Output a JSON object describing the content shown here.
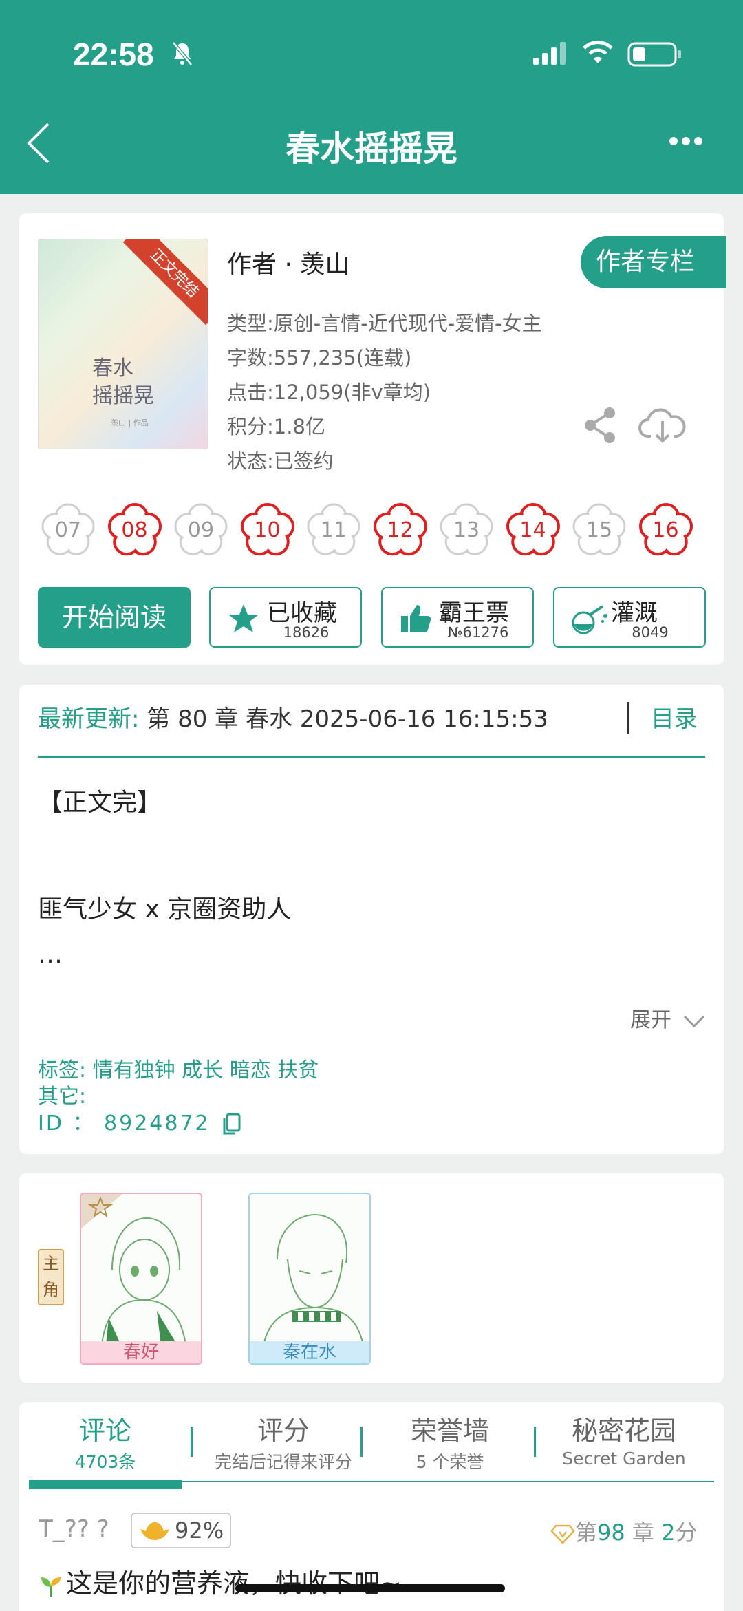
{
  "status": {
    "time": "22:58"
  },
  "nav": {
    "title": "春水摇摇晃"
  },
  "book": {
    "cover_title": "春水\n摇摇晃",
    "cover_sub": "羡山 | 作品",
    "ribbon": "正文完结",
    "author": "作者 · 羡山",
    "author_column": "作者专栏",
    "type": "类型:原创-言情-近代现代-爱情-女主",
    "words": "字数:557,235(连载)",
    "clicks": "点击:12,059(非v章均)",
    "score": "积分:1.8亿",
    "state": "状态:已签约"
  },
  "flowers": [
    {
      "n": "07",
      "red": false
    },
    {
      "n": "08",
      "red": true
    },
    {
      "n": "09",
      "red": false
    },
    {
      "n": "10",
      "red": true
    },
    {
      "n": "11",
      "red": false
    },
    {
      "n": "12",
      "red": true
    },
    {
      "n": "13",
      "red": false
    },
    {
      "n": "14",
      "red": true
    },
    {
      "n": "15",
      "red": false
    },
    {
      "n": "16",
      "red": true
    }
  ],
  "actions": {
    "read": "开始阅读",
    "collect": "已收藏",
    "collect_count": "18626",
    "vote": "霸王票",
    "vote_count": "№61276",
    "water": "灌溉",
    "water_count": "8049"
  },
  "update": {
    "key": "最新更新:",
    "value": " 第 80 章 春水 2025-06-16 16:15:53",
    "toc": "目录"
  },
  "intro": {
    "line1": "【正文完】",
    "line2": "匪气少女 x 京圈资助人",
    "line3": "…",
    "expand": "展开"
  },
  "tags": {
    "tags": "标签: 情有独钟  成长  暗恋  扶贫",
    "other": "其它:",
    "id": "ID  ：  8924872"
  },
  "characters": {
    "lead": "主角",
    "c1": "春好",
    "c2": "秦在水"
  },
  "tabs": [
    {
      "label": "评论",
      "sub": "4703条"
    },
    {
      "label": "评分",
      "sub": "完结后记得来评分"
    },
    {
      "label": "荣誉墙",
      "sub": "5 个荣誉"
    },
    {
      "label": "秘密花园",
      "sub": "Secret Garden"
    }
  ],
  "comment": {
    "user": "T_?? ?",
    "pct": "92%",
    "chap_pre": "第",
    "chap_num": "98",
    "chap_mid": "章",
    "score_num": "2",
    "score_unit": "分",
    "text": "这是你的营养液，快收下吧~"
  },
  "colors": {
    "accent": "#24a08a",
    "red": "#e02020"
  }
}
